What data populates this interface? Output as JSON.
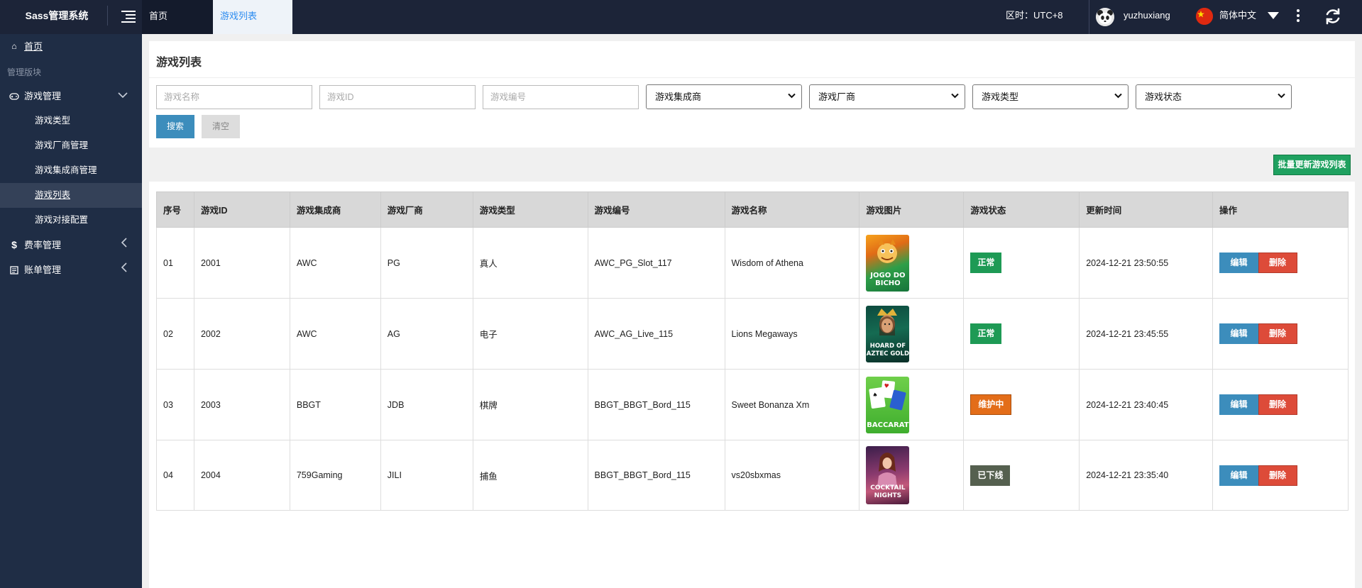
{
  "app": {
    "title": "Sass管理系统"
  },
  "tabs": [
    {
      "label": "首页"
    },
    {
      "label": "游戏列表"
    }
  ],
  "header": {
    "timezone": "区时：UTC+8",
    "username": "yuzhuxiang",
    "language": "简体中文"
  },
  "sidebar": {
    "home": "首页",
    "section_label": "管理版块",
    "game_mgmt": "游戏管理",
    "sub_items": [
      "游戏类型",
      "游戏厂商管理",
      "游戏集成商管理",
      "游戏列表",
      "游戏对接配置"
    ],
    "rate_mgmt": "费率管理",
    "bill_mgmt": "账单管理"
  },
  "search": {
    "page_title": "游戏列表",
    "name_placeholder": "游戏名称",
    "id_placeholder": "游戏ID",
    "code_placeholder": "游戏编号",
    "integrator_select": "游戏集成商",
    "vendor_select": "游戏厂商",
    "type_select": "游戏类型",
    "status_select": "游戏状态",
    "search_button": "搜索",
    "clear_button": "清空"
  },
  "batch_update_button": "批量更新游戏列表",
  "table": {
    "columns": [
      "序号",
      "游戏ID",
      "游戏集成商",
      "游戏厂商",
      "游戏类型",
      "游戏编号",
      "游戏名称",
      "游戏图片",
      "游戏状态",
      "更新时间",
      "操作"
    ],
    "edit_label": "编辑",
    "delete_label": "删除",
    "rows": [
      {
        "no": "01",
        "id": "2001",
        "integrator": "AWC",
        "vendor": "PG",
        "type": "真人",
        "code": "AWC_PG_Slot_117",
        "name": "Wisdom of Athena",
        "image_caption": "JOGO DO BICHO",
        "status": "正常",
        "updated": "2024-12-21 23:50:55"
      },
      {
        "no": "02",
        "id": "2002",
        "integrator": "AWC",
        "vendor": "AG",
        "type": "电子",
        "code": "AWC_AG_Live_115",
        "name": "Lions Megaways",
        "image_caption": "HOARD OF AZTEC GOLD",
        "status": "正常",
        "updated": "2024-12-21 23:45:55"
      },
      {
        "no": "03",
        "id": "2003",
        "integrator": "BBGT",
        "vendor": "JDB",
        "type": "棋牌",
        "code": "BBGT_BBGT_Bord_115",
        "name": "Sweet Bonanza Xm",
        "image_caption": "BACCARAT",
        "status": "维护中",
        "updated": "2024-12-21 23:40:45"
      },
      {
        "no": "04",
        "id": "2004",
        "integrator": "759Gaming",
        "vendor": "JILI",
        "type": "捕鱼",
        "code": "BBGT_BBGT_Bord_115",
        "name": "vs20sbxmas",
        "image_caption": "COCKTAIL NIGHTS",
        "status": "已下线",
        "updated": "2024-12-21 23:35:40"
      }
    ]
  },
  "colors": {
    "topbar": "#1c2438",
    "sidebar": "#1f2d45",
    "primary": "#3c8dbc",
    "success": "#1e9a55",
    "warning": "#e36d19",
    "danger": "#dd4b39"
  }
}
